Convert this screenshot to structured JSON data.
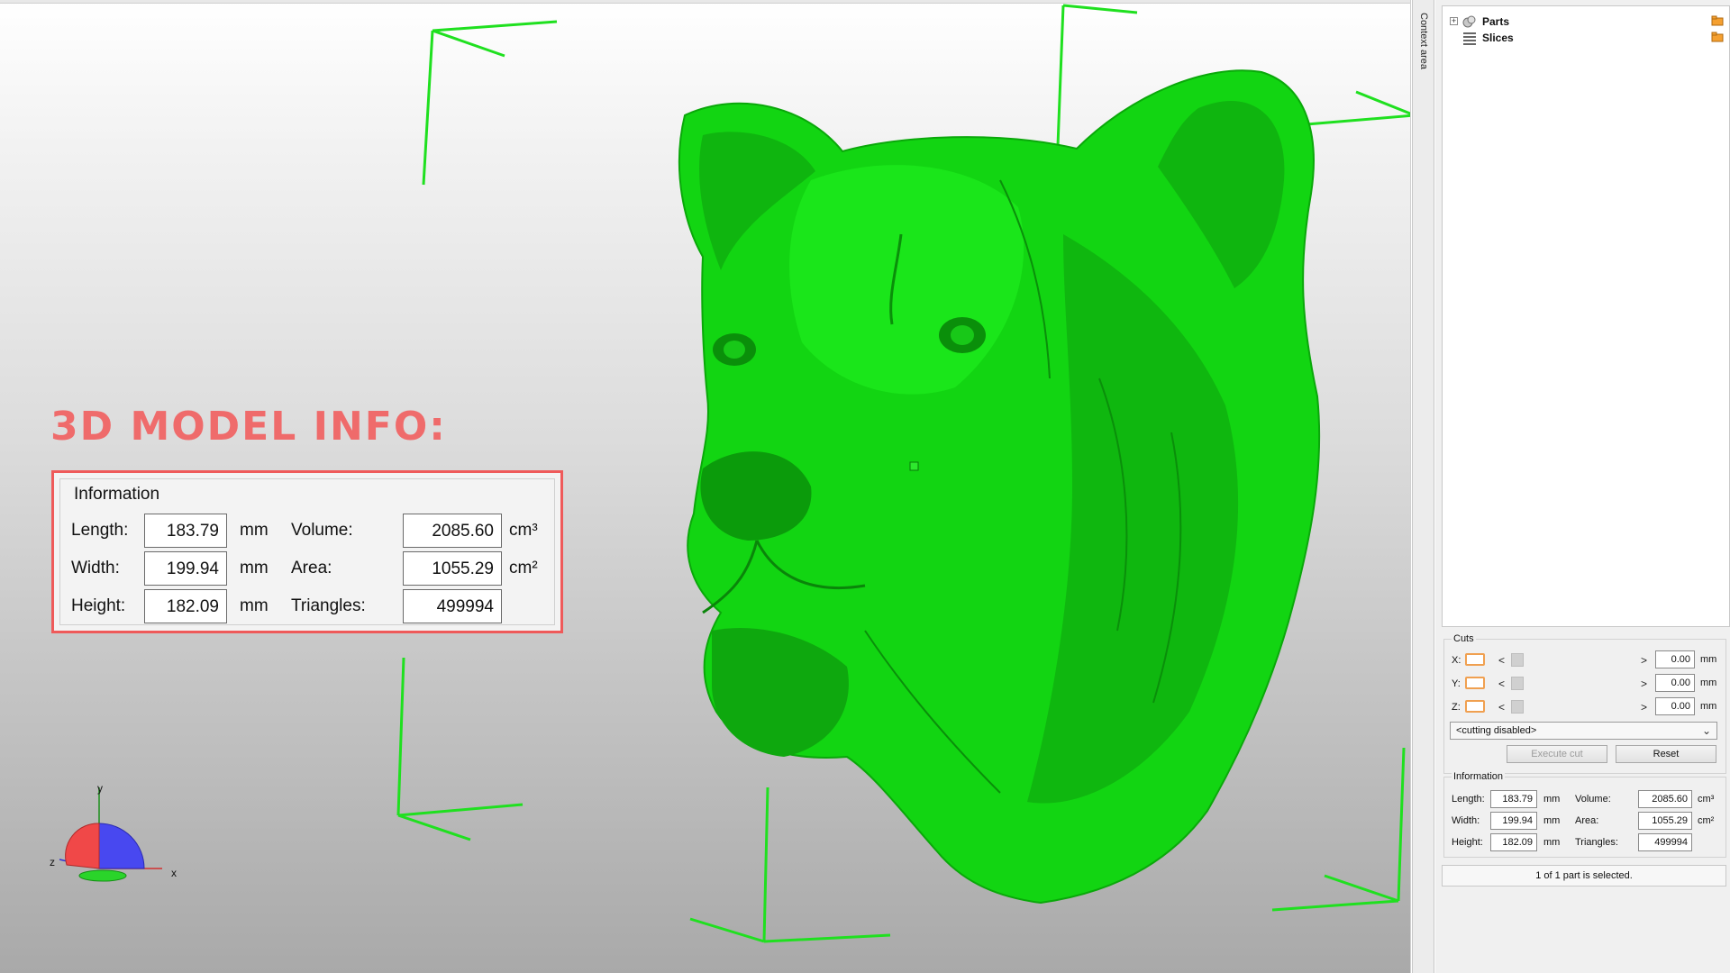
{
  "overlay": {
    "title": "3D MODEL INFO:",
    "group_label": "Information",
    "length_label": "Length:",
    "width_label": "Width:",
    "height_label": "Height:",
    "volume_label": "Volume:",
    "area_label": "Area:",
    "triangles_label": "Triangles:",
    "length_value": "183.79",
    "width_value": "199.94",
    "height_value": "182.09",
    "volume_value": "2085.60",
    "area_value": "1055.29",
    "triangles_value": "499994",
    "mm_unit": "mm",
    "volume_unit": "cm³",
    "area_unit": "cm²"
  },
  "viewport": {
    "model_color": "#11d911",
    "bbox_color": "#1fe01f",
    "axis_labels": {
      "x": "x",
      "y": "y",
      "z": "z"
    }
  },
  "side_strip": {
    "label": "Context area"
  },
  "tree": {
    "items": [
      {
        "label": "Parts",
        "icon": "parts-icon"
      },
      {
        "label": "Slices",
        "icon": "slices-icon"
      }
    ]
  },
  "cuts": {
    "group_label": "Cuts",
    "rows": [
      {
        "axis": "X:",
        "value": "0.00",
        "unit": "mm"
      },
      {
        "axis": "Y:",
        "value": "0.00",
        "unit": "mm"
      },
      {
        "axis": "Z:",
        "value": "0.00",
        "unit": "mm"
      }
    ],
    "left_arrow": "<",
    "right_arrow": ">",
    "mode_select": "<cutting disabled>",
    "execute_label": "Execute cut",
    "reset_label": "Reset"
  },
  "info": {
    "group_label": "Information",
    "length_label": "Length:",
    "width_label": "Width:",
    "height_label": "Height:",
    "volume_label": "Volume:",
    "area_label": "Area:",
    "triangles_label": "Triangles:",
    "length_value": "183.79",
    "width_value": "199.94",
    "height_value": "182.09",
    "volume_value": "2085.60",
    "area_value": "1055.29",
    "triangles_value": "499994",
    "mm_unit": "mm",
    "volume_unit": "cm³",
    "area_unit": "cm²"
  },
  "status": {
    "text": "1 of 1 part is selected."
  }
}
